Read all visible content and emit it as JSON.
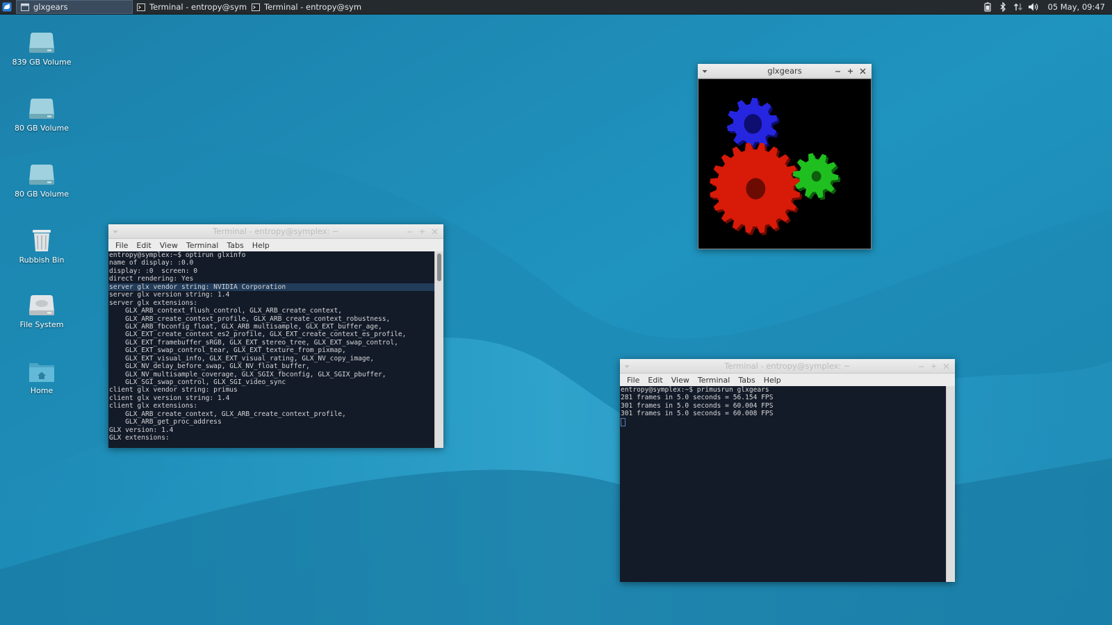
{
  "panel": {
    "tasks": [
      {
        "label": "glxgears",
        "active": true
      },
      {
        "label": "Terminal - entropy@symplex...",
        "active": false
      },
      {
        "label": "Terminal - entropy@symplex...",
        "active": false
      }
    ],
    "clock": "05 May, 09:47",
    "tray_icons": [
      "battery-icon",
      "bluetooth-icon",
      "network-icon",
      "volume-icon"
    ]
  },
  "desktop_icons": [
    {
      "label": "839 GB Volume",
      "icon": "drive-icon"
    },
    {
      "label": "80 GB Volume",
      "icon": "drive-icon"
    },
    {
      "label": "80 GB Volume",
      "icon": "drive-icon"
    },
    {
      "label": "Rubbish Bin",
      "icon": "trash-icon"
    },
    {
      "label": "File System",
      "icon": "harddisk-icon"
    },
    {
      "label": "Home",
      "icon": "home-folder-icon"
    }
  ],
  "glxgears_window": {
    "title": "glxgears",
    "gear_colors": {
      "blue": "#2626e0",
      "red": "#d81a08",
      "green": "#1fbf1f"
    }
  },
  "terminal1": {
    "title": "Terminal - entropy@symplex: ~",
    "menu": [
      "File",
      "Edit",
      "View",
      "Terminal",
      "Tabs",
      "Help"
    ],
    "lines": [
      "entropy@symplex:~$ optirun glxinfo",
      "name of display: :0.0",
      "display: :0  screen: 0",
      "direct rendering: Yes",
      "server glx vendor string: NVIDIA Corporation",
      "server glx version string: 1.4",
      "server glx extensions:",
      "    GLX_ARB_context_flush_control, GLX_ARB_create_context,",
      "    GLX_ARB_create_context_profile, GLX_ARB_create_context_robustness,",
      "    GLX_ARB_fbconfig_float, GLX_ARB_multisample, GLX_EXT_buffer_age,",
      "    GLX_EXT_create_context_es2_profile, GLX_EXT_create_context_es_profile,",
      "    GLX_EXT_framebuffer_sRGB, GLX_EXT_stereo_tree, GLX_EXT_swap_control,",
      "    GLX_EXT_swap_control_tear, GLX_EXT_texture_from_pixmap,",
      "    GLX_EXT_visual_info, GLX_EXT_visual_rating, GLX_NV_copy_image,",
      "    GLX_NV_delay_before_swap, GLX_NV_float_buffer,",
      "    GLX_NV_multisample_coverage, GLX_SGIX_fbconfig, GLX_SGIX_pbuffer,",
      "    GLX_SGI_swap_control, GLX_SGI_video_sync",
      "client glx vendor string: primus",
      "client glx version string: 1.4",
      "client glx extensions:",
      "    GLX_ARB_create_context, GLX_ARB_create_context_profile,",
      "    GLX_ARB_get_proc_address",
      "GLX version: 1.4",
      "GLX extensions:"
    ],
    "highlighted_line": 4
  },
  "terminal2": {
    "title": "Terminal - entropy@symplex: ~",
    "menu": [
      "File",
      "Edit",
      "View",
      "Terminal",
      "Tabs",
      "Help"
    ],
    "lines": [
      "entropy@symplex:~$ primusrun glxgears",
      "281 frames in 5.0 seconds = 56.154 FPS",
      "301 frames in 5.0 seconds = 60.004 FPS",
      "301 frames in 5.0 seconds = 60.008 FPS"
    ]
  }
}
